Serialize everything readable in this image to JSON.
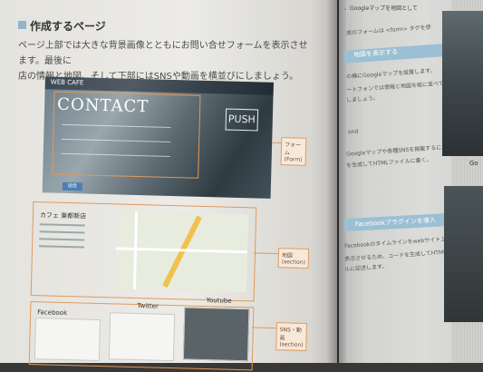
{
  "left_page": {
    "section_title": "作成するページ",
    "intro_line1": "ページ上部では大きな背景画像とともにお問い合せフォームを表示させます。最後に",
    "intro_line2": "店の情報と地図、そして下部にはSNSや動画を横並びにしましょう。",
    "mockup": {
      "logo": "WEB CAFE",
      "heading": "CONTACT",
      "door_sign": "PUSH",
      "submit_button": "送信",
      "shop_name": "カフェ 東都新店",
      "callouts": [
        "フォーム(Form)",
        "地図(section)",
        "SNS・動画(section)"
      ],
      "sns_labels": [
        "Facebook",
        "Twitter",
        "Youtube"
      ]
    }
  },
  "right_page": {
    "top_text": "、Googleマップを地図として",
    "form_tag_line": "成のフォームは <form> タグを使",
    "heading_google_map": "地図を表示する",
    "google_map_text1": "の横にGoogleマップを設置します。",
    "google_map_text2": "ートフォンでは情報と地図を縦に並べて見や",
    "google_map_text3": "しましょう。",
    "sns_label": "ond",
    "sns_text1": "Googleマップや各種SNSを掲載するには、それぞ",
    "sns_text2": "を生成してHTMLファイルに書く。",
    "heading_facebook": "Facebookプラグインを導入",
    "facebook_text1": "Facebookのタイムラインをwebサイト上に",
    "facebook_text2": "表示させるため、コードを生成してHTMLファイ",
    "facebook_text3": "ルに記述します。",
    "go_label": "Go"
  }
}
